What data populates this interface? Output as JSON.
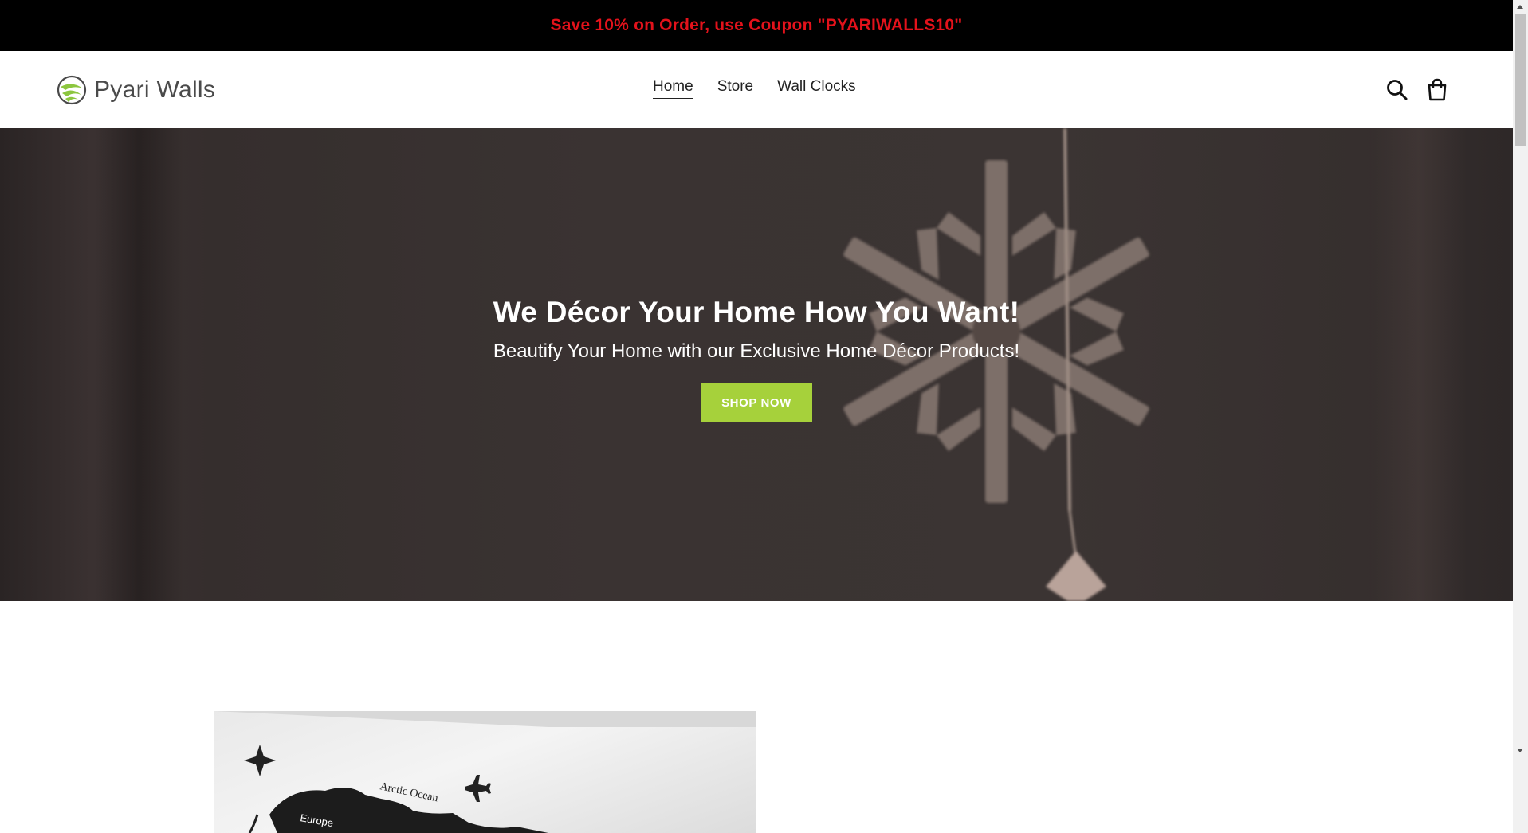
{
  "announcement": {
    "text": "Save 10% on Order, use Coupon \"PYARIWALLS10\""
  },
  "header": {
    "logo_text": "Pyari Walls",
    "nav": [
      {
        "label": "Home",
        "active": true
      },
      {
        "label": "Store",
        "active": false
      },
      {
        "label": "Wall Clocks",
        "active": false
      }
    ],
    "icons": [
      "search-icon",
      "cart-icon"
    ]
  },
  "hero": {
    "title": "We Décor Your Home How You Want!",
    "subtitle": "Beautify Your Home with our Exclusive Home Décor Products!",
    "cta_label": "SHOP NOW"
  },
  "featured_image": {
    "labels": [
      "Arctic Ocean",
      "Europe"
    ]
  },
  "colors": {
    "announcement_bg": "#000000",
    "announcement_text": "#e3121b",
    "cta_bg": "#a6d13b",
    "logo_green": "#8cc63f"
  }
}
